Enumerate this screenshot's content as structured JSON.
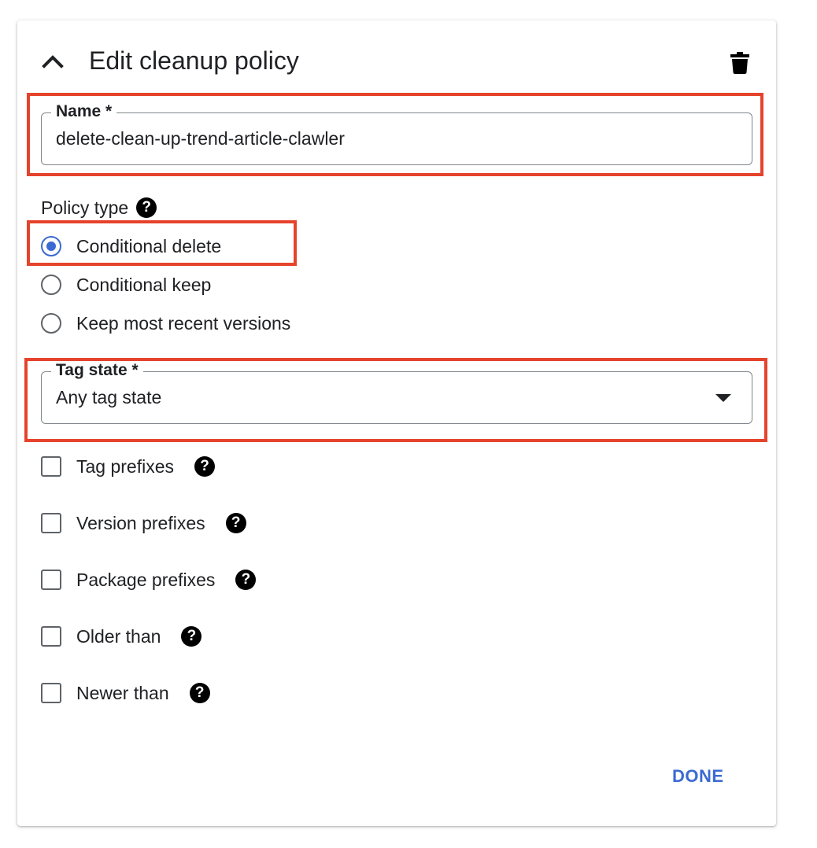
{
  "header": {
    "title": "Edit cleanup policy",
    "collapse_icon": "chevron-up-icon",
    "delete_icon": "trash-icon"
  },
  "name_field": {
    "label": "Name *",
    "value": "delete-clean-up-trend-article-clawler"
  },
  "policy_type": {
    "label": "Policy type",
    "help_icon": "help-icon",
    "options": [
      {
        "label": "Conditional delete",
        "checked": true
      },
      {
        "label": "Conditional keep",
        "checked": false
      },
      {
        "label": "Keep most recent versions",
        "checked": false
      }
    ]
  },
  "tag_state": {
    "label": "Tag state *",
    "value": "Any tag state",
    "dropdown_icon": "dropdown-arrow-icon"
  },
  "filters": [
    {
      "label": "Tag prefixes",
      "checked": false
    },
    {
      "label": "Version prefixes",
      "checked": false
    },
    {
      "label": "Package prefixes",
      "checked": false
    },
    {
      "label": "Older than",
      "checked": false
    },
    {
      "label": "Newer than",
      "checked": false
    }
  ],
  "help_glyph": "?",
  "actions": {
    "done_label": "DONE"
  },
  "colors": {
    "accent": "#3b6ad2",
    "highlight": "#e5432c",
    "text": "#202124",
    "outline": "#80868b"
  }
}
